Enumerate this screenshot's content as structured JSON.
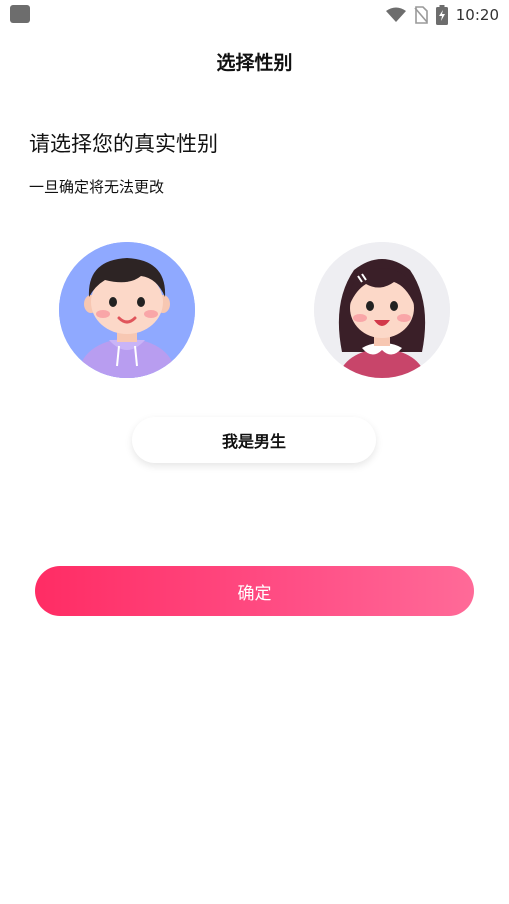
{
  "status_bar": {
    "time": "10:20",
    "icons": [
      "wifi-icon",
      "no-sim-icon",
      "battery-charging-icon"
    ]
  },
  "page": {
    "title": "选择性别",
    "heading": "请选择您的真实性别",
    "subheading": "一旦确定将无法更改"
  },
  "gender": {
    "options": [
      "male",
      "female"
    ],
    "selected_label": "我是男生"
  },
  "confirm_label": "确定",
  "colors": {
    "accent_start": "#ff2c64",
    "accent_end": "#ff6a98",
    "male_avatar_bg": "#8fa9ff",
    "female_avatar_bg": "#eeeef2"
  }
}
